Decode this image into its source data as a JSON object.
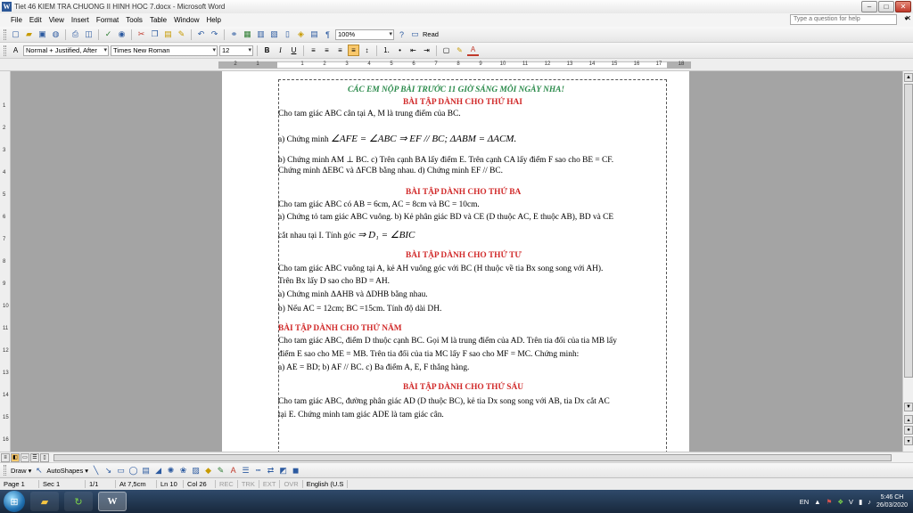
{
  "window": {
    "title": "Tiet 46 KIEM TRA CHUONG II HINH HOC 7.docx - Microsoft Word",
    "app_icon": "W",
    "minimize_glyph": "‒",
    "maximize_glyph": "□",
    "close_glyph": "✕"
  },
  "menu": {
    "items": [
      "File",
      "Edit",
      "View",
      "Insert",
      "Format",
      "Tools",
      "Table",
      "Window",
      "Help"
    ],
    "help_placeholder": "Type a question for help",
    "help_arrow": "▾",
    "doc_close": "✕"
  },
  "toolbar_standard": {
    "zoom": "100%",
    "read_label": "Read",
    "help_glyph": "?"
  },
  "toolbar_formatting": {
    "style": "Normal + Justified, After",
    "font": "Times New Roman",
    "size": "12",
    "aa_glyph": "A",
    "bold": "B",
    "italic": "I",
    "underline": "U",
    "font_color_glyph": "A"
  },
  "ruler": {
    "labels": [
      "2",
      "1",
      "",
      "1",
      "2",
      "3",
      "4",
      "5",
      "6",
      "7",
      "8",
      "9",
      "10",
      "11",
      "12",
      "13",
      "14",
      "15",
      "16",
      "17",
      "18"
    ],
    "vlabels": [
      "1",
      "2",
      "3",
      "4",
      "5",
      "6",
      "7",
      "8",
      "9",
      "10",
      "11",
      "12",
      "13",
      "14",
      "15",
      "16"
    ]
  },
  "document": {
    "header": "CÁC EM NỘP BÀI TRƯỚC 11 GIỜ SÁNG MỖI NGÀY NHA!",
    "monday": {
      "title": "BÀI TẬP DÀNH CHO THỨ HAI",
      "l1": "Cho tam giác ABC cân tại A, M là trung điểm của BC.",
      "l2_prefix": "a) Chứng minh",
      "l2_math": "∠AFE = ∠ABC ⇒ EF // BC;  ΔABM = ΔACM.",
      "l3": "b) Chứng minh AM ⊥ BC.  c) Trên cạnh BA lấy  điểm E. Trên cạnh CA lấy điểm F sao cho BE = CF.",
      "l4": "Chứng minh ΔEBC và ΔFCB bằng nhau.    d) Chứng minh EF // BC."
    },
    "tuesday": {
      "title": "BÀI TẬP DÀNH CHO THỨ BA",
      "l1": "Cho tam giác ABC có AB = 6cm, AC = 8cm và BC = 10cm.",
      "l2": "a) Chứng tỏ tam giác ABC vuông. b) Kẻ phân giác BD và CE (D thuộc AC, E thuộc AB), BD và CE",
      "l3_prefix": "cắt nhau tại I. Tính góc",
      "l3_math": "⇒  D₁ = ∠BIC"
    },
    "wednesday": {
      "title": "BÀI TẬP DÀNH CHO THỨ TƯ",
      "l1": "Cho tam giác ABC vuông tại A, kẻ AH vuông góc với BC (H thuộc về tia Bx song song với AH).",
      "l2": "Trên Bx lấy D sao cho BD = AH.",
      "l3": "a) Chứng minh ΔAHB và ΔDHB bằng nhau.",
      "l4": "b) Nếu AC = 12cm; BC =15cm. Tính độ dài DH."
    },
    "thursday": {
      "title": "BÀI TẬP DÀNH CHO THỨ NĂM",
      "l1": "Cho tam giác ABC, điểm D thuộc cạnh BC. Gọi M là trung điểm của AD. Trên tia đối của tia MB lấy",
      "l2": "điểm E sao cho ME = MB. Trên tia đối của tia MC lấy F sao cho MF = MC. Chứng minh:",
      "l3": "a) AE = BD;       b) AF // BC.            c) Ba điểm A, E, F thẳng hàng."
    },
    "friday": {
      "title": "BÀI TẬP DÀNH CHO THỨ SÁU",
      "l1": "Cho tam giác ABC, đường phân giác AD (D thuộc BC), kẻ tia Dx song song với AB, tia Dx cắt AC",
      "l2": "tại E. Chứng minh tam giác ADE là tam giác cân."
    }
  },
  "drawbar": {
    "draw": "Draw ▾",
    "autoshapes": "AutoShapes ▾"
  },
  "status": {
    "page": "Page 1",
    "sec": "Sec 1",
    "pages": "1/1",
    "at": "At 7,5cm",
    "ln": "Ln 10",
    "col": "Col 26",
    "rec": "REC",
    "trk": "TRK",
    "ext": "EXT",
    "ovr": "OVR",
    "lang": "English (U.S"
  },
  "taskbar": {
    "lang": "EN",
    "time": "5:46 CH",
    "date": "26/03/2020",
    "tray_v": "V",
    "tray_up": "▲"
  }
}
